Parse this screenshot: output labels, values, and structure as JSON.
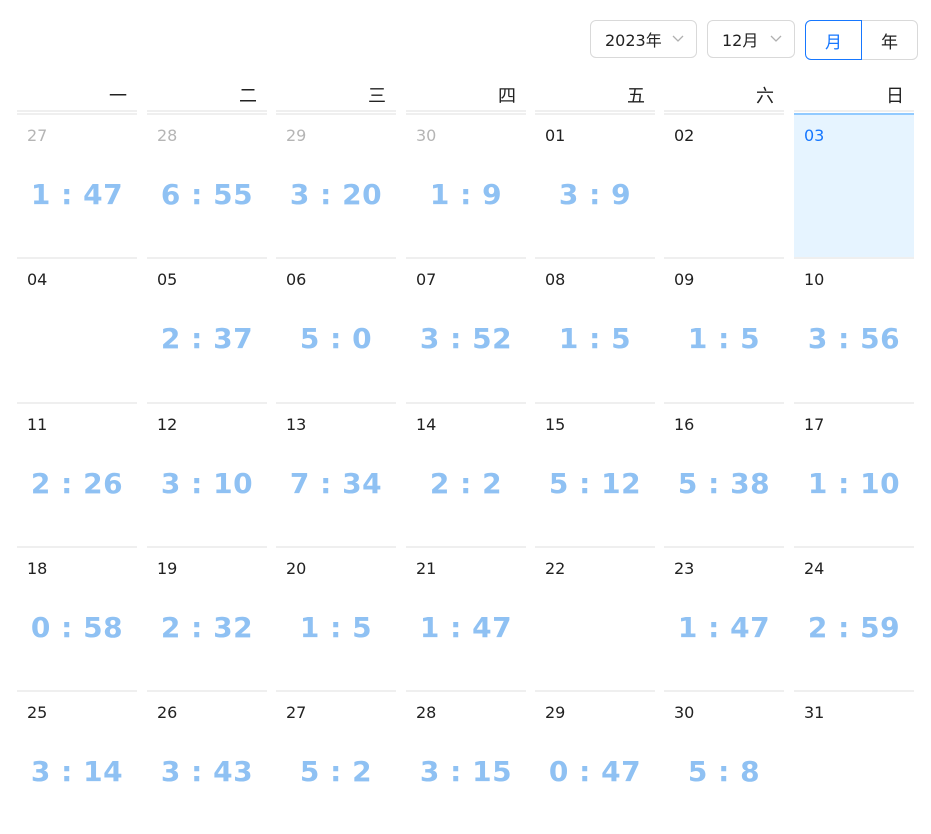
{
  "header": {
    "year_label": "2023年",
    "month_label": "12月",
    "mode_month": "月",
    "mode_year": "年"
  },
  "colors": {
    "accent": "#1677ff",
    "value_text": "#8fc1f3",
    "today_bg": "#e6f4ff",
    "muted_date": "#b5b5b5",
    "grid_line": "#efefef"
  },
  "weekdays": [
    "一",
    "二",
    "三",
    "四",
    "五",
    "六",
    "日"
  ],
  "selected_date": "03",
  "weeks": [
    [
      {
        "date": "27",
        "value": "1 : 47",
        "other_month": true
      },
      {
        "date": "28",
        "value": "6 : 55",
        "other_month": true
      },
      {
        "date": "29",
        "value": "3 : 20",
        "other_month": true
      },
      {
        "date": "30",
        "value": "1 : 9",
        "other_month": true
      },
      {
        "date": "01",
        "value": "3 : 9"
      },
      {
        "date": "02",
        "value": ""
      },
      {
        "date": "03",
        "value": "",
        "today": true
      }
    ],
    [
      {
        "date": "04",
        "value": ""
      },
      {
        "date": "05",
        "value": "2 : 37"
      },
      {
        "date": "06",
        "value": "5 : 0"
      },
      {
        "date": "07",
        "value": "3 : 52"
      },
      {
        "date": "08",
        "value": "1 : 5"
      },
      {
        "date": "09",
        "value": "1 : 5"
      },
      {
        "date": "10",
        "value": "3 : 56"
      }
    ],
    [
      {
        "date": "11",
        "value": "2 : 26"
      },
      {
        "date": "12",
        "value": "3 : 10"
      },
      {
        "date": "13",
        "value": "7 : 34"
      },
      {
        "date": "14",
        "value": "2 : 2"
      },
      {
        "date": "15",
        "value": "5 : 12"
      },
      {
        "date": "16",
        "value": "5 : 38"
      },
      {
        "date": "17",
        "value": "1 : 10"
      }
    ],
    [
      {
        "date": "18",
        "value": "0 : 58"
      },
      {
        "date": "19",
        "value": "2 : 32"
      },
      {
        "date": "20",
        "value": "1 : 5"
      },
      {
        "date": "21",
        "value": "1 : 47"
      },
      {
        "date": "22",
        "value": ""
      },
      {
        "date": "23",
        "value": "1 : 47"
      },
      {
        "date": "24",
        "value": "2 : 59"
      }
    ],
    [
      {
        "date": "25",
        "value": "3 : 14"
      },
      {
        "date": "26",
        "value": "3 : 43"
      },
      {
        "date": "27",
        "value": "5 : 2"
      },
      {
        "date": "28",
        "value": "3 : 15"
      },
      {
        "date": "29",
        "value": "0 : 47"
      },
      {
        "date": "30",
        "value": "5 : 8"
      },
      {
        "date": "31",
        "value": ""
      }
    ]
  ]
}
